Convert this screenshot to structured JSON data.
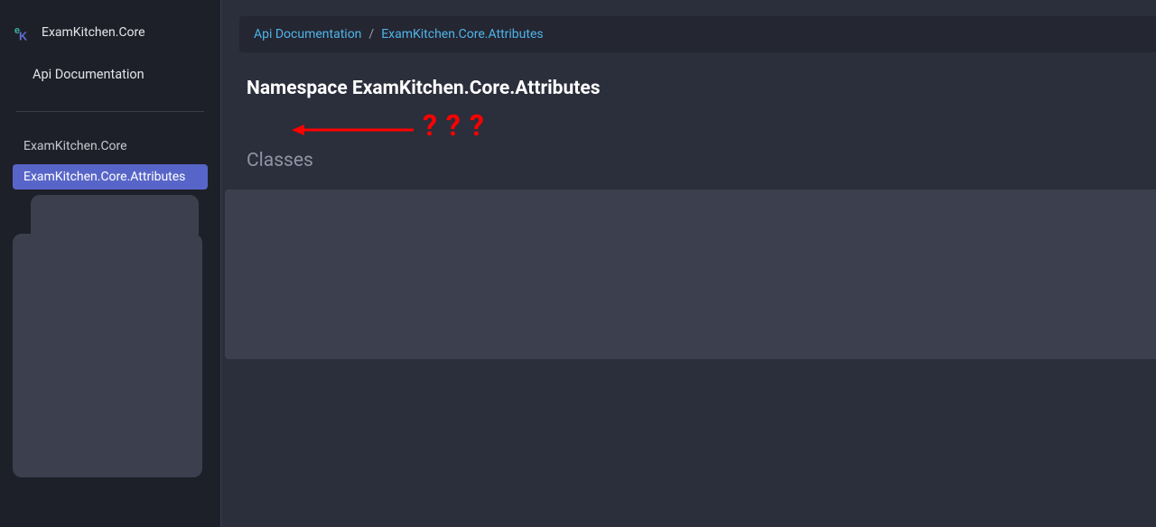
{
  "sidebar": {
    "brand": "ExamKitchen.Core",
    "subtitle": "Api Documentation",
    "items": [
      {
        "label": "ExamKitchen.Core",
        "active": false
      },
      {
        "label": "ExamKitchen.Core.Attributes",
        "active": true
      }
    ]
  },
  "breadcrumb": {
    "items": [
      {
        "label": "Api Documentation"
      },
      {
        "label": "ExamKitchen.Core.Attributes"
      }
    ],
    "separator": "/"
  },
  "page": {
    "title": "Namespace ExamKitchen.Core.Attributes",
    "section_header": "Classes",
    "annotation_text": "???"
  }
}
